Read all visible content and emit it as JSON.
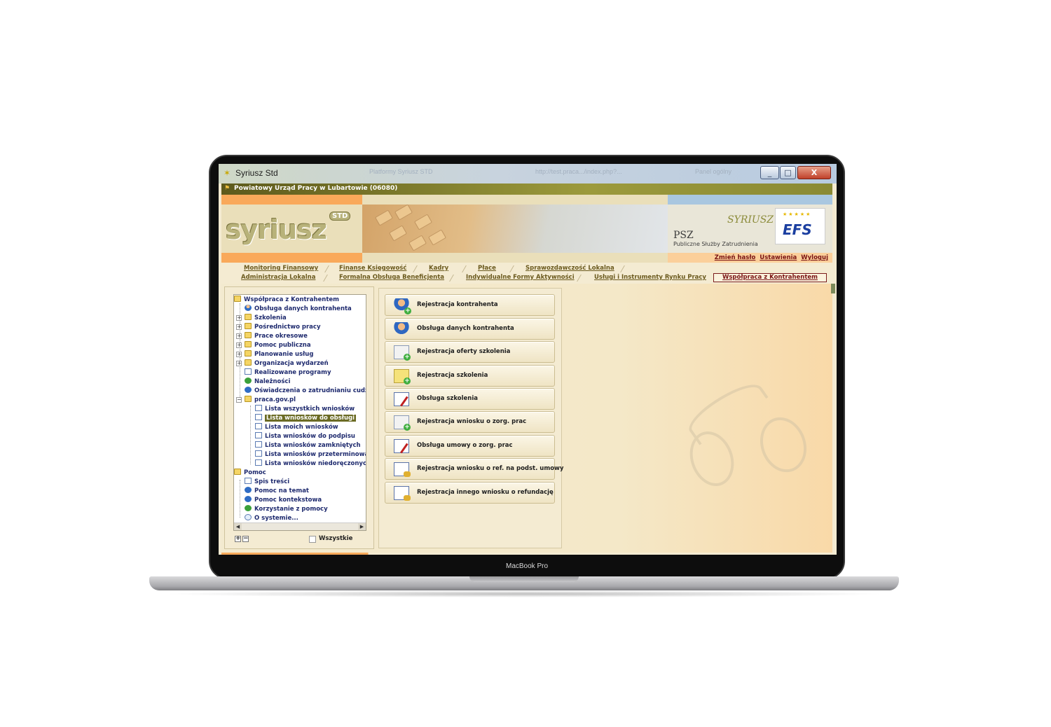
{
  "device": {
    "label": "MacBook Pro"
  },
  "window": {
    "title": "Syriusz Std",
    "ghost_tabs": [
      "Platformy Syriusz STD",
      "http://test.praca.../index.php?...",
      "Panel ogólny"
    ],
    "controls": {
      "minimize": "_",
      "maximize": "□",
      "close": "X"
    }
  },
  "org": {
    "name": "Powiatowy Urząd Pracy w Lubartowie (06080)"
  },
  "banner": {
    "logo_text": "syriusz",
    "logo_badge": "STD",
    "psz_abbr": "PSZ",
    "psz_full": "Publiczne Służby Zatrudnienia",
    "partner_logo_text": "SYRIUSZ",
    "efs_text": "EFS"
  },
  "user_links": {
    "change_password": "Zmień hasło",
    "settings": "Ustawienia",
    "logout": "Wyloguj"
  },
  "menu": {
    "row1": [
      "Monitoring Finansowy",
      "Finanse Księgowość",
      "Kadry",
      "Płace",
      "Sprawozdawczość Lokalna"
    ],
    "row2": [
      "Administracja Lokalna",
      "Formalna Obsługa Beneficjenta",
      "Indywidualne Formy Aktywności",
      "Usługi i Instrumenty Rynku Pracy"
    ],
    "active": "Współpraca z Kontrahentem"
  },
  "tree": {
    "root": "Współpraca z Kontrahentem",
    "items": [
      "Obsługa danych kontrahenta",
      "Szkolenia",
      "Pośrednictwo pracy",
      "Prace okresowe",
      "Pomoc publiczna",
      "Planowanie usług",
      "Organizacja wydarzeń",
      "Realizowane programy",
      "Należności",
      "Oświadczenia o zatrudnianiu cudzozie"
    ],
    "praca_gov": "praca.gov.pl",
    "praca_items": [
      "Lista wszystkich wniosków",
      "Lista wniosków do obsługi",
      "Lista moich wniosków",
      "Lista wniosków do podpisu",
      "Lista wniosków zamkniętych",
      "Lista wniosków przeterminowanych",
      "Lista wniosków niedoręczonych"
    ],
    "selected": "Lista wniosków do obsługi",
    "help_root": "Pomoc",
    "help_items": [
      "Spis treści",
      "Pomoc na temat",
      "Pomoc kontekstowa",
      "Korzystanie z pomocy",
      "O systemie..."
    ],
    "expand_all": "+",
    "collapse_all": "−",
    "show_all_label": "Wszystkie"
  },
  "actions": [
    {
      "label": "Rejestracja kontrahenta",
      "icon": "person-add-icon"
    },
    {
      "label": "Obsługa danych kontrahenta",
      "icon": "person-icon"
    },
    {
      "label": "Rejestracja oferty szkolenia",
      "icon": "mail-add-icon"
    },
    {
      "label": "Rejestracja szkolenia",
      "icon": "note-add-icon"
    },
    {
      "label": "Obsługa szkolenia",
      "icon": "document-edit-icon"
    },
    {
      "label": "Rejestracja wniosku o zorg. prac",
      "icon": "mail-add-icon"
    },
    {
      "label": "Obsługa umowy o zorg. prac",
      "icon": "document-edit-icon"
    },
    {
      "label": "Rejestracja wniosku o ref. na podst. umowy",
      "icon": "document-coins-icon"
    },
    {
      "label": "Rejestracja innego wniosku o refundację",
      "icon": "document-coins-icon"
    }
  ],
  "colors": {
    "accent_orange": "#f9a95a",
    "olive": "#6b6b24",
    "text_red": "#7a1313",
    "background": "#f4ebd2"
  }
}
